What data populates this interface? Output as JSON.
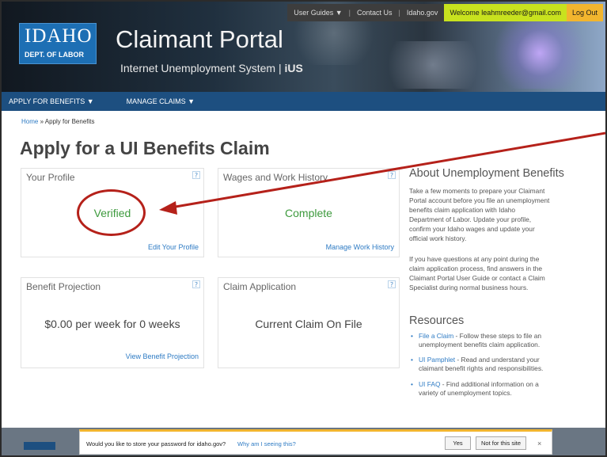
{
  "header": {
    "logo_big": "IDAHO",
    "logo_small": "DEPT. OF LABOR",
    "title": "Claimant Portal",
    "subtitle": "Internet Unemployment System |",
    "subtitle_mark": "iUS",
    "topnav": {
      "user_guides": "User Guides ▼",
      "contact_us": "Contact Us",
      "idaho_gov": "Idaho.gov",
      "welcome": "Welcome leahmreeder@gmail.com",
      "log_out": "Log Out"
    }
  },
  "mainnav": {
    "apply": "APPLY FOR BENEFITS ▼",
    "manage": "MANAGE CLAIMS ▼"
  },
  "breadcrumb": {
    "home": "Home",
    "sep": " » ",
    "current": "Apply for Benefits"
  },
  "page_title": "Apply for a UI Benefits Claim",
  "cards": {
    "profile": {
      "title": "Your Profile",
      "help": "?",
      "status": "Verified",
      "link": "Edit Your Profile"
    },
    "wages": {
      "title": "Wages and Work History",
      "help": "?",
      "status": "Complete",
      "link": "Manage Work History"
    },
    "projection": {
      "title": "Benefit Projection",
      "help": "?",
      "status": "$0.00 per week for 0 weeks",
      "link": "View Benefit Projection"
    },
    "claim": {
      "title": "Claim Application",
      "help": "?",
      "status": "Current Claim On File"
    }
  },
  "sidebar": {
    "about_heading": "About Unemployment Benefits",
    "about_p1_lines": [
      "Take a few moments to prepare your Claimant",
      "Portal account before you file an unemployment",
      "benefits claim application with Idaho",
      "Department of Labor. Update your profile,",
      "confirm your Idaho wages and update your",
      "official work history."
    ],
    "about_p2_lines": [
      "If you have questions at any point during the",
      "claim application process, find answers in the",
      "Claimant Portal User Guide or contact a Claim",
      "Specialist during normal business hours."
    ],
    "resources_heading": "Resources",
    "resources": [
      {
        "link": "File a Claim",
        "line1": " - Follow these steps to file an",
        "line2": "unemployment benefits claim application."
      },
      {
        "link": "UI Pamphlet",
        "line1": " - Read and understand your",
        "line2": "claimant benefit rights and responsibilities."
      },
      {
        "link": "UI FAQ",
        "line1": " - Find additional information on a",
        "line2": "variety of unemployment topics."
      }
    ]
  },
  "password_bar": {
    "message": "Would you like to store your password for idaho.gov?",
    "why": "Why am I seeing this?",
    "yes": "Yes",
    "not_for_site": "Not for this site",
    "close": "×"
  },
  "colors": {
    "nav_blue": "#1d4f80",
    "link_blue": "#2e7bc4",
    "status_green": "#3d9a3d",
    "annotation_red": "#b5211a",
    "welcome_yellow": "#c8e21e",
    "logout_orange": "#f2b52e"
  }
}
